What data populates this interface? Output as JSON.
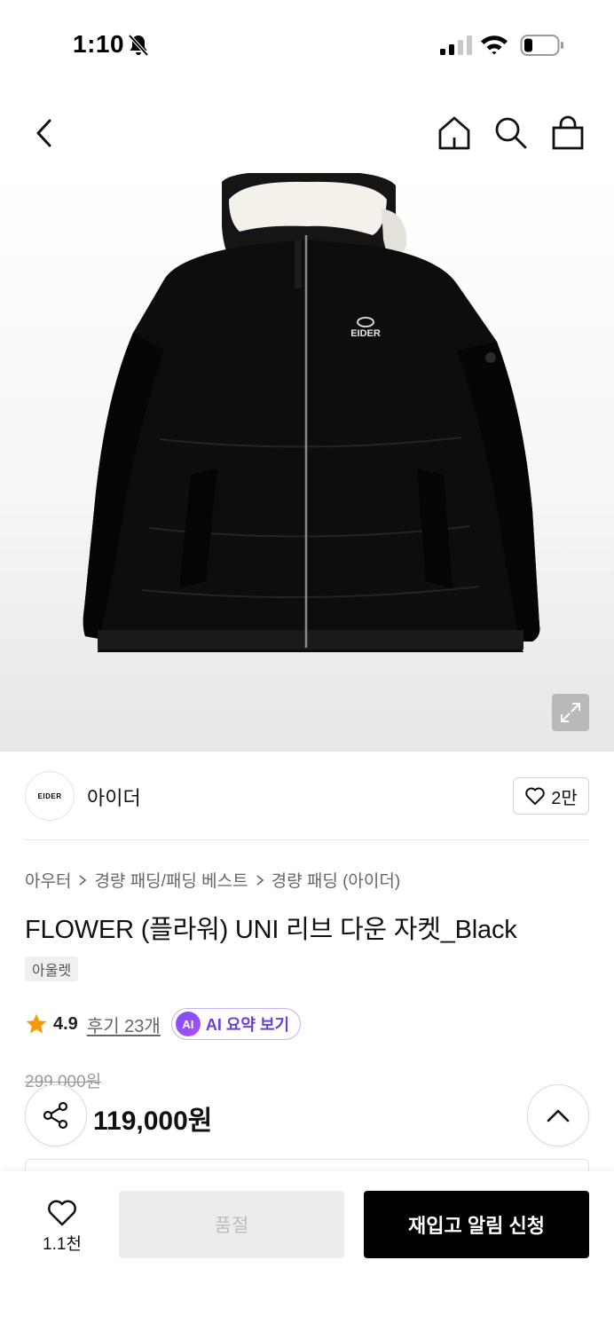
{
  "status_bar": {
    "time": "1:10"
  },
  "brand": {
    "name": "아이더",
    "logo_text": "EIDER",
    "likes": "2만"
  },
  "breadcrumb": [
    "아우터",
    "경량 패딩/패딩 베스트",
    "경량 패딩 (아이더)"
  ],
  "product": {
    "title": "FLOWER (플라워) UNI 리브 다운 자켓_Black",
    "tag": "아울렛",
    "jacket_logo_text": "EIDER",
    "rating": "4.9",
    "reviews": "후기 23개",
    "ai_badge": "AI",
    "ai_summary": "AI 요약 보기",
    "original_price": "299,000원",
    "sale_price": "119,000원"
  },
  "bottom_bar": {
    "wish_count": "1.1천",
    "soldout_label": "품절",
    "restock_label": "재입고 알림 신청"
  },
  "icons": [
    "mute-icon",
    "signal-icon",
    "wifi-icon",
    "battery-icon",
    "back-icon",
    "home-icon",
    "search-icon",
    "shopping-bag-icon",
    "expand-icon",
    "heart-icon",
    "chevron-right-icon",
    "star-icon",
    "share-icon",
    "chevron-up-icon"
  ],
  "colors": {
    "accent_purple": "#6b3fd8",
    "star": "#f59a0c",
    "primary_button": "#000000",
    "disabled_button": "#ececec"
  }
}
